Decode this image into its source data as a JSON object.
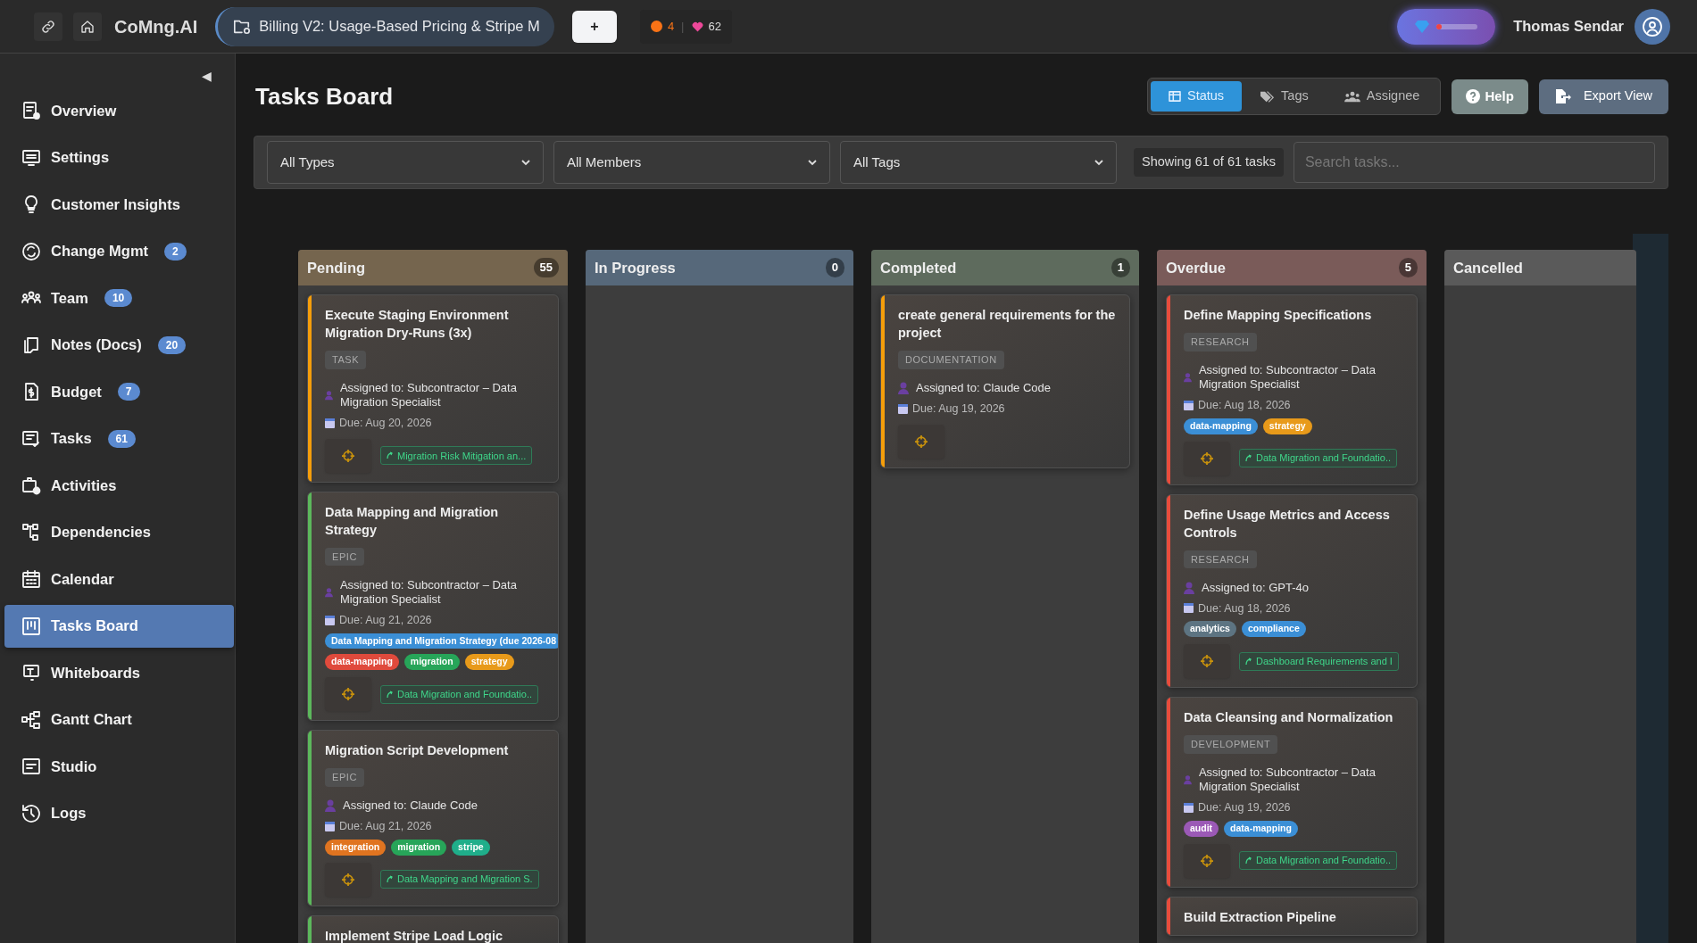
{
  "top_bar": {
    "brand": "CoMng.AI",
    "project": "Billing V2: Usage-Based Pricing & Stripe M",
    "add_button": "+",
    "stats": [
      {
        "kind": "dot",
        "value": "4",
        "color": "#f97316"
      },
      {
        "kind": "heart",
        "value": "62",
        "color": "#ec4899"
      }
    ],
    "separator": "|",
    "credits": {
      "level": 0.06
    },
    "user": "Thomas Sendar"
  },
  "sidebar": {
    "collapse": "◀",
    "items": [
      {
        "label": "Overview",
        "selected": false
      },
      {
        "label": "Settings",
        "selected": false
      },
      {
        "label": "Customer Insights",
        "selected": false
      },
      {
        "label": "Change Mgmt",
        "badge": "2",
        "selected": false
      },
      {
        "label": "Team",
        "badge": "10",
        "selected": false
      },
      {
        "label": "Notes (Docs)",
        "badge": "20",
        "selected": false
      },
      {
        "label": "Budget",
        "badge": "7",
        "selected": false
      },
      {
        "label": "Tasks",
        "badge": "61",
        "selected": false
      },
      {
        "label": "Activities",
        "selected": false
      },
      {
        "label": "Dependencies",
        "selected": false
      },
      {
        "label": "Calendar",
        "selected": false
      },
      {
        "label": "Tasks Board",
        "selected": true
      },
      {
        "label": "Whiteboards",
        "selected": false
      },
      {
        "label": "Gantt Chart",
        "selected": false
      },
      {
        "label": "Studio",
        "selected": false
      },
      {
        "label": "Logs",
        "selected": false
      }
    ]
  },
  "header": {
    "title": "Tasks Board",
    "view_tabs": [
      {
        "label": "Status",
        "selected": true
      },
      {
        "label": "Tags",
        "selected": false
      },
      {
        "label": "Assignee",
        "selected": false
      }
    ],
    "help": "Help",
    "export": "Export View"
  },
  "filters": {
    "selects": [
      "All Types",
      "All Members",
      "All Tags"
    ],
    "count": "Showing 61 of 61 tasks",
    "search": {
      "placeholder": "Search tasks..."
    }
  },
  "columns": [
    {
      "name": "Pending",
      "count": "55",
      "color": "#75654e",
      "cards": [
        {
          "title": "Execute Staging Environment Migration Dry-Runs (3x)",
          "type": "TASK",
          "assignee": "Assigned to: Subcontractor – Data Migration Specialist",
          "due": "Due: Aug 20, 2026",
          "color": "#f59e0b",
          "link": "Migration Risk Mitigation an..."
        },
        {
          "title": "Data Mapping and Migration Strategy",
          "type": "EPIC",
          "assignee": "Assigned to: Subcontractor – Data Migration Specialist",
          "due": "Due: Aug 21, 2026",
          "color": "#5cb85c",
          "tags": [
            {
              "label": "Data Mapping and Migration Strategy (due 2026-08",
              "color": "#3b8fd6"
            },
            {
              "label": "data-mapping",
              "color": "#e04a3c"
            },
            {
              "label": "migration",
              "color": "#27a559"
            },
            {
              "label": "strategy",
              "color": "#e89a1a"
            }
          ],
          "link": "Data Migration and Foundatio.."
        },
        {
          "title": "Migration Script Development",
          "type": "EPIC",
          "assignee": "Assigned to: Claude Code",
          "due": "Due: Aug 21, 2026",
          "color": "#5cb85c",
          "tags": [
            {
              "label": "integration",
              "color": "#e07420"
            },
            {
              "label": "migration",
              "color": "#27a559"
            },
            {
              "label": "stripe",
              "color": "#1fae8a"
            }
          ],
          "link": "Data Mapping and Migration S."
        },
        {
          "title": "Implement Stripe Load Logic",
          "color": "#5cb85c"
        }
      ]
    },
    {
      "name": "In Progress",
      "count": "0",
      "color": "#56687a"
    },
    {
      "name": "Completed",
      "count": "1",
      "color": "#5e6b5d",
      "cards": [
        {
          "title": "create general requirements for the project",
          "type": "DOCUMENTATION",
          "assignee": "Assigned to: Claude Code",
          "due": "Due: Aug 19, 2026",
          "color": "#f59e0b"
        }
      ]
    },
    {
      "name": "Overdue",
      "count": "5",
      "color": "#7a5b59",
      "cards": [
        {
          "title": "Define Mapping Specifications",
          "type": "RESEARCH",
          "assignee": "Assigned to: Subcontractor – Data Migration Specialist",
          "due": "Due: Aug 18, 2026",
          "color": "#e74c3c",
          "tags": [
            {
              "label": "data-mapping",
              "color": "#3b8fd6"
            },
            {
              "label": "strategy",
              "color": "#e89a1a"
            }
          ],
          "link": "Data Migration and Foundatio.."
        },
        {
          "title": "Define Usage Metrics and Access Controls",
          "type": "RESEARCH",
          "assignee": "Assigned to: GPT-4o",
          "due": "Due: Aug 18, 2026",
          "color": "#e74c3c",
          "tags": [
            {
              "label": "analytics",
              "color": "#5d7482"
            },
            {
              "label": "compliance",
              "color": "#3b8fd6"
            }
          ],
          "link": "Dashboard Requirements and I"
        },
        {
          "title": "Data Cleansing and Normalization",
          "type": "DEVELOPMENT",
          "assignee": "Assigned to: Subcontractor – Data Migration Specialist",
          "due": "Due: Aug 19, 2026",
          "color": "#e74c3c",
          "tags": [
            {
              "label": "audit",
              "color": "#9b59b6"
            },
            {
              "label": "data-mapping",
              "color": "#3b8fd6"
            }
          ],
          "link": "Data Migration and Foundatio.."
        },
        {
          "title": "Build Extraction Pipeline",
          "color": "#e74c3c"
        }
      ]
    },
    {
      "name": "Cancelled",
      "color": "#5a5a5a"
    }
  ]
}
